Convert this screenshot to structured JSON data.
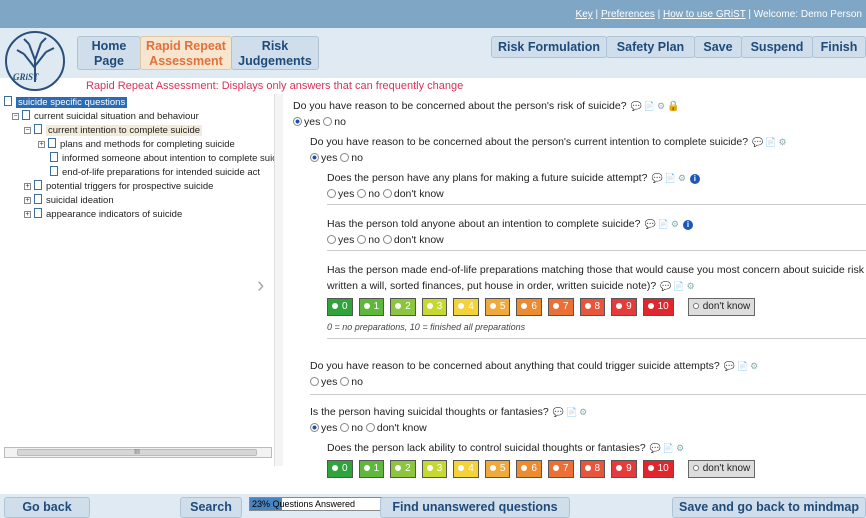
{
  "top_links": {
    "key": "Key",
    "sep1": " | ",
    "preferences": "Preferences",
    "sep2": " | ",
    "howto": "How to use GRiST",
    "sep3": " | ",
    "welcome": "Welcome: Demo Person"
  },
  "logo_text": "GRiST",
  "nav": {
    "home": "Home Page",
    "rapid": "Rapid Repeat Assessment",
    "risk": "Risk Judgements"
  },
  "right_buttons": {
    "formulation": "Risk Formulation",
    "safety": "Safety Plan",
    "save": "Save",
    "suspend": "Suspend",
    "finish": "Finish"
  },
  "subtitle": "Rapid Repeat Assessment: Displays only answers that can frequently change",
  "tree": {
    "root": "suicide specific questions",
    "n1": "current suicidal situation and behaviour",
    "n2": "current intention to complete suicide",
    "n3": "plans and methods for completing suicide",
    "n4": "informed someone about intention to complete suic",
    "n5": "end-of-life preparations for intended suicide act",
    "n6": "potential triggers for prospective suicide",
    "n7": "suicidal ideation",
    "n8": "appearance indicators of suicide",
    "scroll_grip": "III"
  },
  "questions": {
    "q1": "Do you have reason to be concerned about the person's risk of suicide?",
    "q1_yes": "yes",
    "q1_no": "no",
    "q2": "Do you have reason to be concerned about the person's current intention to complete suicide?",
    "q2_yes": "yes",
    "q2_no": "no",
    "q3": "Does the person have any plans for making a future suicide attempt?",
    "q3_yes": "yes",
    "q3_no": "no",
    "q3_dk": "don't know",
    "q4": "Has the person told anyone about an intention to complete suicide?",
    "q4_yes": "yes",
    "q4_no": "no",
    "q4_dk": "don't know",
    "q5_l1": "Has the person made end-of-life preparations matching those that would cause you most concern about suicide risk (eg",
    "q5_l2": "written a will, sorted finances, put house in order, written suicide note)?",
    "q5_note": "0 = no preparations, 10 = finished all preparations",
    "q6": "Do you have reason to be concerned about anything that could trigger suicide attempts?",
    "q6_yes": "yes",
    "q6_no": "no",
    "q7": "Is the person having suicidal thoughts or fantasies?",
    "q7_yes": "yes",
    "q7_no": "no",
    "q7_dk": "don't know",
    "q8": "Does the person lack ability to control suicidal thoughts or fantasies?",
    "dont_know": "don't know"
  },
  "scale_values": [
    "0",
    "1",
    "2",
    "3",
    "4",
    "5",
    "6",
    "7",
    "8",
    "9",
    "10"
  ],
  "scale_colors": [
    "#2fa43a",
    "#5db83b",
    "#8cc63f",
    "#c6d92f",
    "#f4d23a",
    "#f2a93b",
    "#ee8a30",
    "#ec7036",
    "#e9553a",
    "#e53b3a",
    "#e1262c"
  ],
  "bottom": {
    "back": "Go back",
    "search": "Search",
    "progress": "23% Questions Answered",
    "progress_value": 0.23,
    "find": "Find unanswered questions",
    "save_back": "Save and go back to mindmap"
  }
}
